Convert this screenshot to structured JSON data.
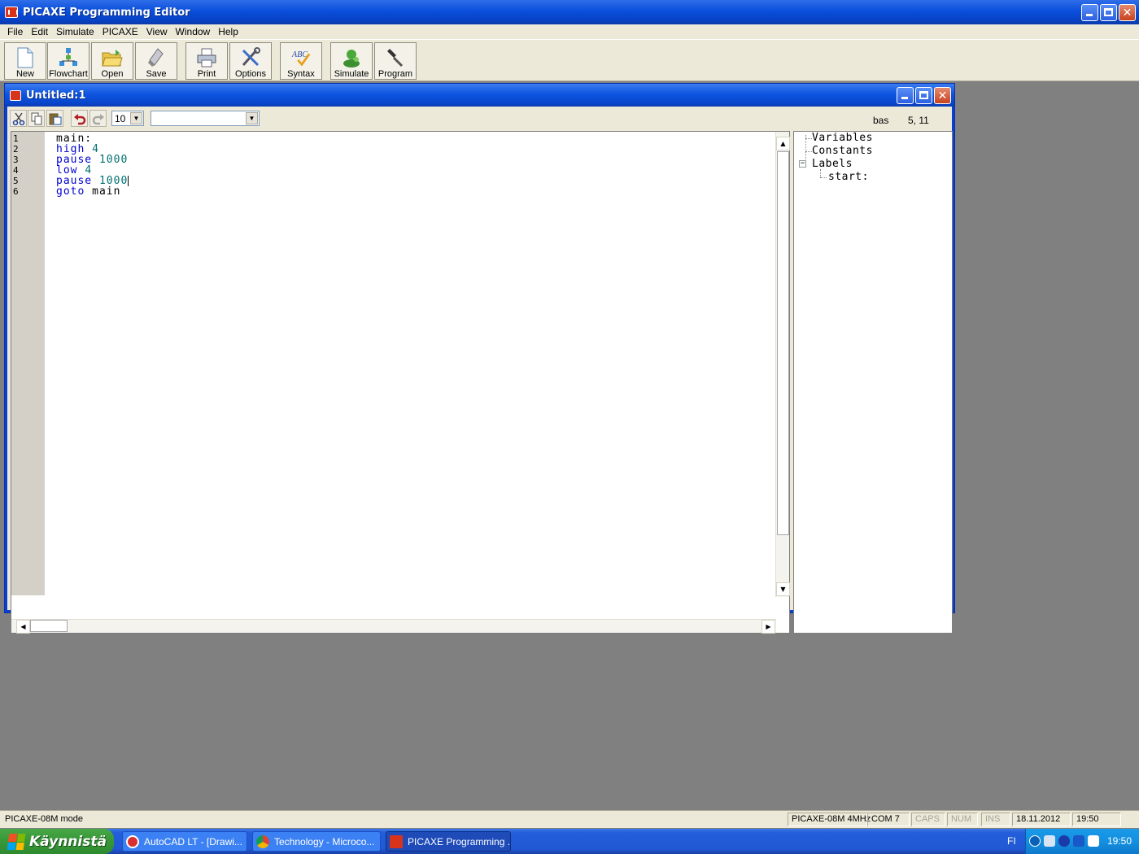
{
  "window": {
    "title": "PICAXE Programming Editor"
  },
  "menu": [
    "File",
    "Edit",
    "Simulate",
    "PICAXE",
    "View",
    "Window",
    "Help"
  ],
  "toolbar": {
    "new": "New",
    "flowchart": "Flowchart",
    "open": "Open",
    "save": "Save",
    "print": "Print",
    "options": "Options",
    "syntax": "Syntax",
    "simulate": "Simulate",
    "program": "Program"
  },
  "document": {
    "title": "Untitled:1",
    "font_size": "10",
    "label_select": "",
    "file_type": "bas",
    "cursor_pos": "5, 11",
    "code": [
      {
        "n": "1",
        "kw": "",
        "arg": "main:"
      },
      {
        "n": "2",
        "kw": "high",
        "arg": "4"
      },
      {
        "n": "3",
        "kw": "pause",
        "arg": "1000"
      },
      {
        "n": "4",
        "kw": "low",
        "arg": "4"
      },
      {
        "n": "5",
        "kw": "pause",
        "arg": "1000"
      },
      {
        "n": "6",
        "kw": "goto",
        "arg": "main"
      }
    ]
  },
  "tree": {
    "variables": "Variables",
    "constants": "Constants",
    "labels": "Labels",
    "label_start": "start:"
  },
  "status": {
    "mode": "PICAXE-08M mode",
    "chip": "PICAXE-08M 4MHz",
    "port": "COM 7",
    "caps": "CAPS",
    "num": "NUM",
    "ins": "INS",
    "date": "18.11.2012",
    "time": "19:50"
  },
  "taskbar": {
    "start": "Käynnistä",
    "tasks": [
      "AutoCAD LT - [Drawi...",
      "Technology - Microco...",
      "PICAXE Programming ..."
    ],
    "lang": "FI",
    "clock": "19:50"
  },
  "colors": {
    "keyword": "#0000d0",
    "number": "#007070",
    "titlebar": "#0a4fdc",
    "desktop": "#808080"
  }
}
